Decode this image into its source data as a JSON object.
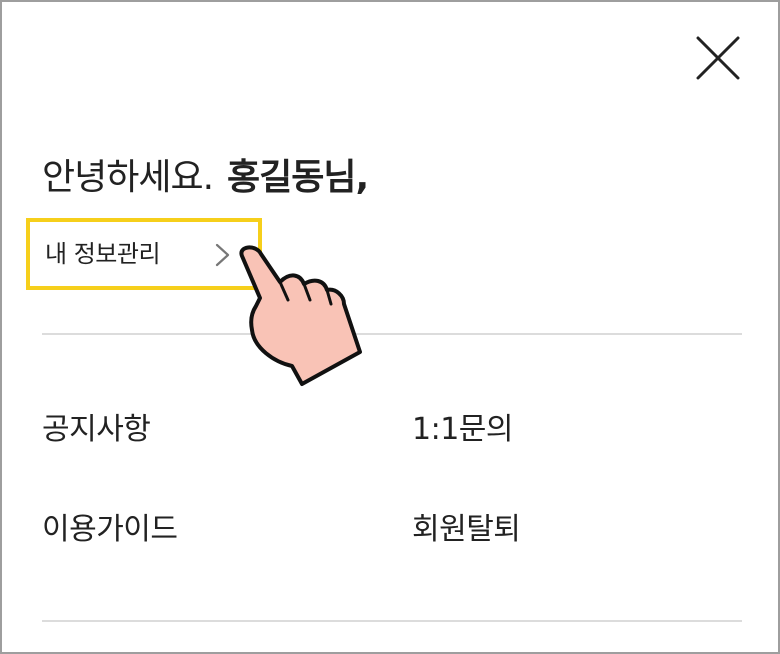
{
  "header": {
    "close_icon": "close-icon"
  },
  "greeting": {
    "hello": "안녕하세요.",
    "username": "홍길동님,"
  },
  "profile_link": {
    "label": "내 정보관리",
    "icon": "chevron-right-icon",
    "highlight_color": "#f6cf1b"
  },
  "menu": {
    "notice": "공지사항",
    "inquiry": "1:1문의",
    "guide": "이용가이드",
    "withdraw": "회원탈퇴"
  },
  "overlay": {
    "icon": "pointing-hand-icon",
    "skin_color": "#f9c3b6"
  },
  "colors": {
    "text": "#222222",
    "divider": "#dcdcdc",
    "frame_border": "#9e9e9e"
  }
}
